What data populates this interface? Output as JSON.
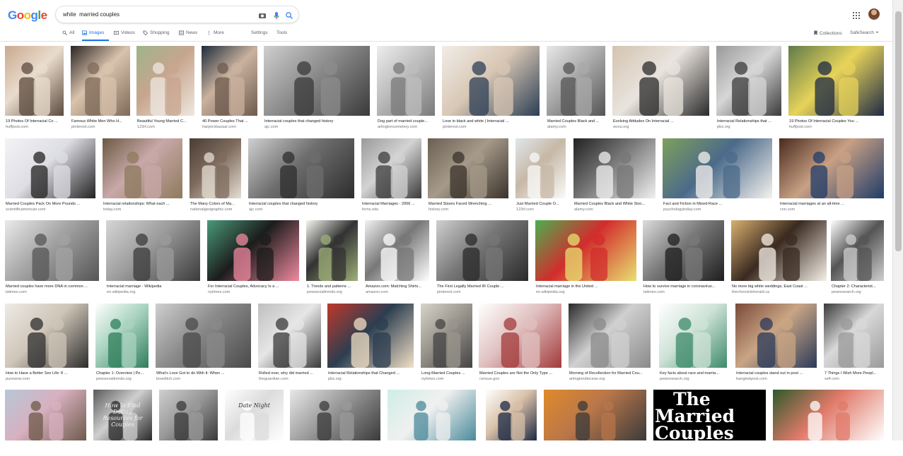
{
  "logo": {
    "letters": [
      "G",
      "o",
      "o",
      "g",
      "l",
      "e"
    ]
  },
  "search": {
    "query": "white  married couples"
  },
  "tabs": [
    {
      "label": "All",
      "icon": "search-icon",
      "active": false
    },
    {
      "label": "Images",
      "icon": "image-icon",
      "active": true
    },
    {
      "label": "Videos",
      "icon": "video-icon",
      "active": false
    },
    {
      "label": "Shopping",
      "icon": "tag-icon",
      "active": false
    },
    {
      "label": "News",
      "icon": "news-icon",
      "active": false
    },
    {
      "label": "More",
      "icon": "dots-icon",
      "active": false
    }
  ],
  "tools": {
    "settings": "Settings",
    "tools": "Tools"
  },
  "right": {
    "collections": "Collections",
    "safesearch": "SafeSearch"
  },
  "rows": [
    [
      {
        "caption": "19 Photos Of Interracial Co ...",
        "domain": "huffpost.com",
        "colors": [
          "#c9a98e",
          "#5c4a3f",
          "#e9dccd"
        ]
      },
      {
        "caption": "Famous White Men Who H...",
        "domain": "pinterest.com",
        "colors": [
          "#2b2522",
          "#7d6a58",
          "#d9c3ad"
        ]
      },
      {
        "caption": "Beautiful Young Married C...",
        "domain": "123rf.com",
        "colors": [
          "#9fb48a",
          "#eee8e0",
          "#c7a58f"
        ]
      },
      {
        "caption": "40 Power Couples That ...",
        "domain": "harpersbazaar.com",
        "colors": [
          "#1f2b3b",
          "#6e5a4d",
          "#c9b29e"
        ]
      },
      {
        "caption": "Interracial couples that changed history",
        "domain": "ajc.com",
        "colors": [
          "#cfcfcf",
          "#3a3a3a",
          "#8c8c8c"
        ]
      },
      {
        "caption": "Dog part of married couple...",
        "domain": "arlingtoncemetery.com",
        "colors": [
          "#ededed",
          "#7a7a7a",
          "#bdbdbd"
        ]
      },
      {
        "caption": "Love in black and white | Interracial ...",
        "domain": "pinterest.com",
        "colors": [
          "#f1ede8",
          "#2c3e55",
          "#d8c7b4"
        ]
      },
      {
        "caption": "Married Couples Black and ...",
        "domain": "alamy.com",
        "colors": [
          "#e8e8e8",
          "#555",
          "#aaa"
        ]
      },
      {
        "caption": "Evolving Attitudes On Interracial ...",
        "domain": "wvxu.org",
        "colors": [
          "#d4c3b0",
          "#2a2a2a",
          "#e9e4de"
        ]
      },
      {
        "caption": "Interracial Relationships that ...",
        "domain": "pbs.org",
        "colors": [
          "#9a9a9a",
          "#3b3b3b",
          "#d6d6d6"
        ]
      },
      {
        "caption": "19 Photos Of Interracial Couples You ...",
        "domain": "huffpost.com",
        "colors": [
          "#5f7a4a",
          "#1e2a44",
          "#e7d35a"
        ]
      }
    ],
    [
      {
        "caption": "Married Couples Pack On More Pounds ...",
        "domain": "scientificamerican.com",
        "colors": [
          "#f4f4f6",
          "#222",
          "#dddde4"
        ]
      },
      {
        "caption": "Interracial relationships: What each ...",
        "domain": "today.com",
        "colors": [
          "#6b5a43",
          "#8e7a5d",
          "#c8a8a8"
        ]
      },
      {
        "caption": "The Many Colors of Ma...",
        "domain": "nationalgeographic.com",
        "colors": [
          "#4b3d35",
          "#e6ddd3",
          "#7d6b5d"
        ]
      },
      {
        "caption": "Interracial couples that changed history",
        "domain": "ajc.com",
        "colors": [
          "#d0d0d0",
          "#2d2d2d",
          "#6e6e6e"
        ]
      },
      {
        "caption": "Interracial Marriages - 2006 ...",
        "domain": "ferris.edu",
        "colors": [
          "#9a9a9a",
          "#3c3c3c",
          "#d3d3d3"
        ]
      },
      {
        "caption": "Married Slaves Faced Wrenching ...",
        "domain": "history.com",
        "colors": [
          "#6a5f52",
          "#3a332b",
          "#a69a8a"
        ]
      },
      {
        "caption": "Just Married Couple O...",
        "domain": "123rf.com",
        "colors": [
          "#dfe7ec",
          "#fafafa",
          "#c7b8a6"
        ]
      },
      {
        "caption": "Married Couples Black and White Stoc...",
        "domain": "alamy.com",
        "colors": [
          "#222",
          "#f0f0f0",
          "#777"
        ]
      },
      {
        "caption": "Fact and Fiction in Mixed-Race ...",
        "domain": "psychologytoday.com",
        "colors": [
          "#7fa05a",
          "#f5f2ee",
          "#4b6a8a"
        ]
      },
      {
        "caption": "Interracial marriages at an all-time ...",
        "domain": "cnn.com",
        "colors": [
          "#4a2a1e",
          "#1f3b6a",
          "#c8a084"
        ]
      }
    ],
    [
      {
        "caption": "Married couples have more DNA in common ...",
        "domain": "latimes.com",
        "colors": [
          "#eaeaea",
          "#555",
          "#a3a3a3"
        ]
      },
      {
        "caption": "Interracial marriage - Wikipedia",
        "domain": "en.wikipedia.org",
        "colors": [
          "#d6d6d6",
          "#3b3b3b",
          "#9b9b9b"
        ]
      },
      {
        "caption": "For Interracial Couples, Advocacy Is a ...",
        "domain": "nytimes.com",
        "colors": [
          "#4a9a7a",
          "#f08aa0",
          "#1c1c1c"
        ]
      },
      {
        "caption": "1. Trends and patterns ...",
        "domain": "pewsocialtrends.org",
        "colors": [
          "#f6f6f0",
          "#9fb07a",
          "#333"
        ]
      },
      {
        "caption": "Amazon.com: Matching Shirts...",
        "domain": "amazon.com",
        "colors": [
          "#f2f2f2",
          "#ffffff",
          "#777"
        ]
      },
      {
        "caption": "The First Legally Married IR Couple ...",
        "domain": "pinterest.com",
        "colors": [
          "#cfcfcf",
          "#2a2a2a",
          "#777"
        ]
      },
      {
        "caption": "Interracial marriage in the United ...",
        "domain": "en.wikipedia.org",
        "colors": [
          "#4caf50",
          "#e8e070",
          "#d22c2c"
        ]
      },
      {
        "caption": "How to survive marriage in coronavirus...",
        "domain": "latimes.com",
        "colors": [
          "#dcdcdc",
          "#1e1e1e",
          "#7a7a7a"
        ]
      },
      {
        "caption": "No more big white weddings, East Coast ...",
        "domain": "thechronicleherald.ca",
        "colors": [
          "#d9b070",
          "#f5f0e8",
          "#3a2a20"
        ]
      },
      {
        "caption": "Chapter 2: Characterist...",
        "domain": "pewresearch.org",
        "colors": [
          "#ffffff",
          "#cfcfcf",
          "#555"
        ]
      }
    ],
    [
      {
        "caption": "How to Have a Better Sex Life: 8 ...",
        "domain": "purewow.com",
        "colors": [
          "#eeeae6",
          "#2d2d2d",
          "#cfc5b8"
        ]
      },
      {
        "caption": "Chapter 1: Overview | Pe...",
        "domain": "pewsocialtrends.org",
        "colors": [
          "#ffffff",
          "#2f7d5b",
          "#a9d3c0"
        ]
      },
      {
        "caption": "What's Love Got to do With It: When ...",
        "domain": "bowditch.com",
        "colors": [
          "#cfcfcf",
          "#4a4a4a",
          "#8a8a8a"
        ]
      },
      {
        "caption": "Rolled over, why did married ...",
        "domain": "theguardian.com",
        "colors": [
          "#bfbfbf",
          "#3a3a3a",
          "#e6e6e6"
        ]
      },
      {
        "caption": "Interracial Relationships that Changed ...",
        "domain": "pbs.org",
        "colors": [
          "#c0392b",
          "#f2e0c6",
          "#2c3e50"
        ]
      },
      {
        "caption": "Long-Married Couples ...",
        "domain": "nytimes.com",
        "colors": [
          "#d8d4cc",
          "#444",
          "#9a968e"
        ]
      },
      {
        "caption": "Married Couples are Not the Only Type ...",
        "domain": "census.gov",
        "colors": [
          "#ffffff",
          "#a33a3a",
          "#e0c0c0"
        ]
      },
      {
        "caption": "Morning of Recollection for Married Cou...",
        "domain": "arlingtondiocese.org",
        "colors": [
          "#2a2a2a",
          "#8a8a8a",
          "#d0d0d0"
        ]
      },
      {
        "caption": "Key facts about race and marria...",
        "domain": "pewresearch.org",
        "colors": [
          "#ffffff",
          "#3d8a6a",
          "#cfe3d8"
        ]
      },
      {
        "caption": "Interracial couples stand out in post ...",
        "domain": "bangkokpost.com",
        "colors": [
          "#7a4a3a",
          "#2a3a5a",
          "#c9a584"
        ]
      },
      {
        "caption": "7 Things I Wish More Peopl...",
        "domain": "self.com",
        "colors": [
          "#3a3a3a",
          "#9a9a9a",
          "#d8d8d8"
        ]
      }
    ],
    [
      {
        "caption": "",
        "domain": "",
        "colors": [
          "#b7c7d6",
          "#6e5a4a",
          "#d8b0c0"
        ]
      },
      {
        "caption": "",
        "domain": "",
        "colors": [
          "#5a5a5a",
          "#2a2a2a",
          "#cfcfcf"
        ],
        "overlay": "How to Find Dating Resources for Couples"
      },
      {
        "caption": "",
        "domain": "",
        "colors": [
          "#cfcfcf",
          "#3a3a3a",
          "#9a9a9a"
        ]
      },
      {
        "caption": "",
        "domain": "",
        "colors": [
          "#ffffff",
          "#ffffff",
          "#dcdcdc"
        ],
        "overlay": "Date Night"
      },
      {
        "caption": "",
        "domain": "",
        "colors": [
          "#e8e8e8",
          "#3a3a3a",
          "#9a9a9a"
        ]
      },
      {
        "caption": "",
        "domain": "",
        "colors": [
          "#cfeee6",
          "#4a8a9a",
          "#f0f0f0"
        ]
      },
      {
        "caption": "",
        "domain": "",
        "colors": [
          "#ffffff",
          "#1e2a44",
          "#d8c0a8"
        ]
      },
      {
        "caption": "",
        "domain": "",
        "colors": [
          "#e08a2a",
          "#3a3a3a",
          "#b8764a"
        ]
      },
      {
        "caption": "",
        "domain": "",
        "colors": [
          "#000000",
          "#000000",
          "#000000"
        ],
        "bigtext": [
          "The",
          "Married",
          "Couples"
        ]
      },
      {
        "caption": "",
        "domain": "",
        "colors": [
          "#2f5a2a",
          "#ffffff",
          "#e07a6a"
        ]
      }
    ]
  ]
}
